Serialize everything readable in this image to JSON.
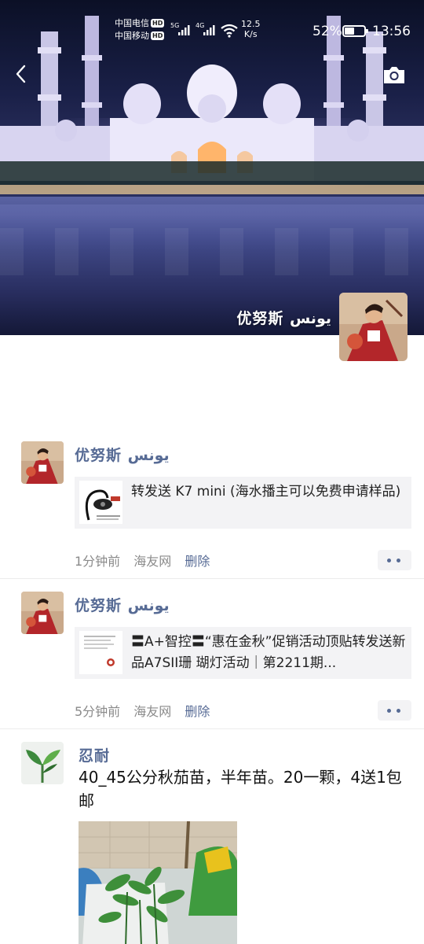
{
  "status_bar": {
    "carrier1": "中国电信",
    "carrier2": "中国移动",
    "hd_badge": "HD",
    "net1": "5G",
    "net2": "4G",
    "net_speed_value": "12.5",
    "net_speed_unit": "K/s",
    "battery_percent": "52%",
    "battery_level": 0.52,
    "time": "13:56"
  },
  "header": {
    "back_icon": "chevron-left-icon",
    "camera_icon": "camera-icon",
    "profile_name": "优努斯 يونس"
  },
  "posts": [
    {
      "author": "优努斯 يونس",
      "share_text": "转发送 K7 mini (海水播主可以免费申请样品)",
      "time": "1分钟前",
      "source": "海友网",
      "delete": "删除"
    },
    {
      "author": "优努斯 يونس",
      "share_text": "〓A+智控〓“惠在金秋”促销活动顶贴转发送新品A7SII珊 瑚灯活动｜第2211期...",
      "time": "5分钟前",
      "source": "海友网",
      "delete": "删除"
    },
    {
      "author": "忍耐",
      "text": "40_45公分秋茄苗，半年苗。20一颗，4送1包邮"
    }
  ],
  "colors": {
    "link": "#576b95",
    "meta": "#8a8a8a",
    "share_bg": "#f3f3f5"
  }
}
